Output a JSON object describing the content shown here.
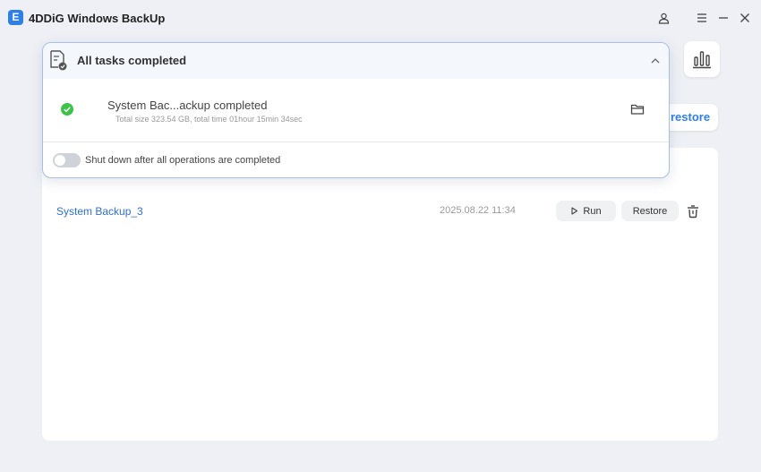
{
  "app": {
    "logo_letter": "E",
    "title": "4DDiG Windows BackUp",
    "icons": {
      "account": "user-icon",
      "menu": "menu-icon",
      "minimize": "minimize-icon",
      "close": "close-icon"
    }
  },
  "side_actions": {
    "stats_icon": "bar-chart-icon",
    "restore_label": "restore"
  },
  "popup": {
    "title": "All tasks completed",
    "task": {
      "title": "System Bac...ackup completed",
      "detail": "Total size 323.54 GB, total time 01hour 15min 34sec",
      "status_color": "#3cc44a"
    },
    "shutdown_label": "Shut down after all operations are completed",
    "shutdown_enabled": false
  },
  "backups": [
    {
      "name": "System Backup_3",
      "date": "2025.08.22 11:34",
      "run_label": "Run",
      "restore_label": "Restore"
    }
  ],
  "colors": {
    "accent": "#2f80e6",
    "link": "#2f6fd4",
    "popup_border": "#a8bfe0"
  }
}
